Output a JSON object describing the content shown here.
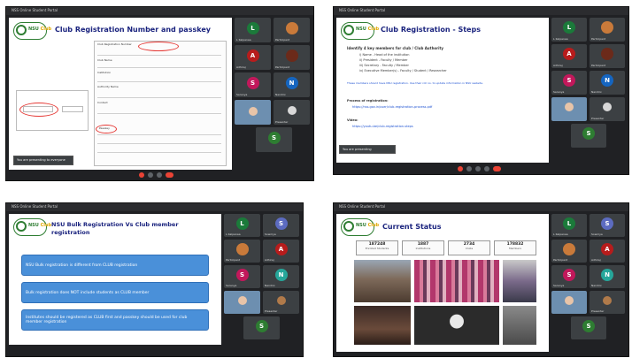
{
  "screens": [
    {
      "window_title": "NSS Online Student Portal",
      "slide_title": "Club Registration Number and passkey",
      "logo_text": "NSU",
      "logo_accent": "Club",
      "form_fields": [
        "Club Registration Number",
        "Passkey",
        "Club Name",
        "Institution",
        "Authority Name",
        "Contact"
      ],
      "participants": [
        {
          "initial": "L",
          "color": "#1b7a3a",
          "name": "L Kalpanaa"
        },
        {
          "initial": "",
          "color": "#8a5a3c",
          "name": "Participant"
        },
        {
          "initial": "A",
          "color": "#b71c1c",
          "name": "Adhiraj"
        },
        {
          "initial": "",
          "color": "#444444",
          "name": "Participant"
        },
        {
          "initial": "S",
          "color": "#c2185b",
          "name": "Saranya"
        },
        {
          "initial": "N",
          "color": "#1565c0",
          "name": "Nandini"
        },
        {
          "initial": "",
          "color": "#8fa8c0",
          "name": "You"
        },
        {
          "initial": "",
          "color": "#555555",
          "name": "Presenter"
        },
        {
          "initial": "S",
          "color": "#2e7d32",
          "name": "Shalini"
        }
      ],
      "present_notice": "You are presenting to everyone"
    },
    {
      "window_title": "NSS Online Student Portal",
      "slide_title": "Club Registration - Steps",
      "logo_text": "NSU",
      "logo_accent": "Club",
      "steps_heading": "Identify 4 key members for club / Club Authority",
      "steps": [
        "i) Name - Head of the institution",
        "ii) President - Faculty / Member",
        "iii) Secretary - Faculty / Member",
        "iv) Executive Member(s) - Faculty / Student / Researcher"
      ],
      "note": "These members should have NSU registration. Use their roll no. to update information in NSU website.",
      "process_label": "Process of registration:",
      "process_link": "https://nss.gov.in/user/club-registration-process.pdf",
      "video_label": "Video:",
      "video_link": "https://youtu.be/club-registration-steps",
      "participants": [
        {
          "initial": "L",
          "color": "#1b7a3a",
          "name": "L Kalpanaa"
        },
        {
          "initial": "",
          "color": "#8a5a3c",
          "name": "Participant"
        },
        {
          "initial": "A",
          "color": "#b71c1c",
          "name": "Adhiraj"
        },
        {
          "initial": "",
          "color": "#444444",
          "name": "Participant"
        },
        {
          "initial": "S",
          "color": "#c2185b",
          "name": "Saranya"
        },
        {
          "initial": "N",
          "color": "#1565c0",
          "name": "Nandini"
        },
        {
          "initial": "",
          "color": "#8fa8c0",
          "name": "You"
        },
        {
          "initial": "",
          "color": "#555555",
          "name": "Presenter"
        },
        {
          "initial": "S",
          "color": "#2e7d32",
          "name": "Shalini"
        }
      ],
      "present_notice": "You are presenting"
    },
    {
      "window_title": "NSS Online Student Portal",
      "slide_title_line1": "NSU Bulk Registration Vs Club member",
      "slide_title_line2": "registration",
      "logo_text": "NSU",
      "logo_accent": "Club",
      "points": [
        "NSU Bulk registration is different from CLUB registration",
        "Bulk registration does NOT include students as CLUB member",
        "Institutes should be registered as CLUB first and passkey should be used for club member registration"
      ],
      "participants": [
        {
          "initial": "L",
          "color": "#1b7a3a",
          "name": "L Kalpanaa"
        },
        {
          "initial": "S",
          "color": "#5c6bc0",
          "name": "Sowmya"
        },
        {
          "initial": "",
          "color": "#8a5a3c",
          "name": "Participant"
        },
        {
          "initial": "A",
          "color": "#b71c1c",
          "name": "Adhiraj"
        },
        {
          "initial": "S",
          "color": "#c2185b",
          "name": "Saranya"
        },
        {
          "initial": "N",
          "color": "#26a69a",
          "name": "Nandini"
        },
        {
          "initial": "",
          "color": "#8fa8c0",
          "name": "You"
        },
        {
          "initial": "",
          "color": "#555555",
          "name": "Presenter"
        },
        {
          "initial": "S",
          "color": "#2e7d32",
          "name": "Shalini"
        }
      ]
    },
    {
      "window_title": "NSS Online Student Portal",
      "slide_title": "Current Status",
      "logo_text": "NSU",
      "logo_accent": "Club",
      "stats": [
        {
          "value": "187248",
          "label": "Enrolled Students"
        },
        {
          "value": "1887",
          "label": "Institutions"
        },
        {
          "value": "2734",
          "label": "Clubs"
        },
        {
          "value": "178832",
          "label": "Members"
        }
      ],
      "participants": [
        {
          "initial": "L",
          "color": "#1b7a3a",
          "name": "L Kalpanaa"
        },
        {
          "initial": "S",
          "color": "#5c6bc0",
          "name": "Sowmya"
        },
        {
          "initial": "",
          "color": "#8a5a3c",
          "name": "Participant"
        },
        {
          "initial": "A",
          "color": "#b71c1c",
          "name": "Adhiraj"
        },
        {
          "initial": "S",
          "color": "#c2185b",
          "name": "Saranya"
        },
        {
          "initial": "N",
          "color": "#26a69a",
          "name": "Nandini"
        },
        {
          "initial": "",
          "color": "#8fa8c0",
          "name": "You"
        },
        {
          "initial": "",
          "color": "#555555",
          "name": "Presenter"
        },
        {
          "initial": "S",
          "color": "#2e7d32",
          "name": "Shalini"
        }
      ]
    }
  ]
}
